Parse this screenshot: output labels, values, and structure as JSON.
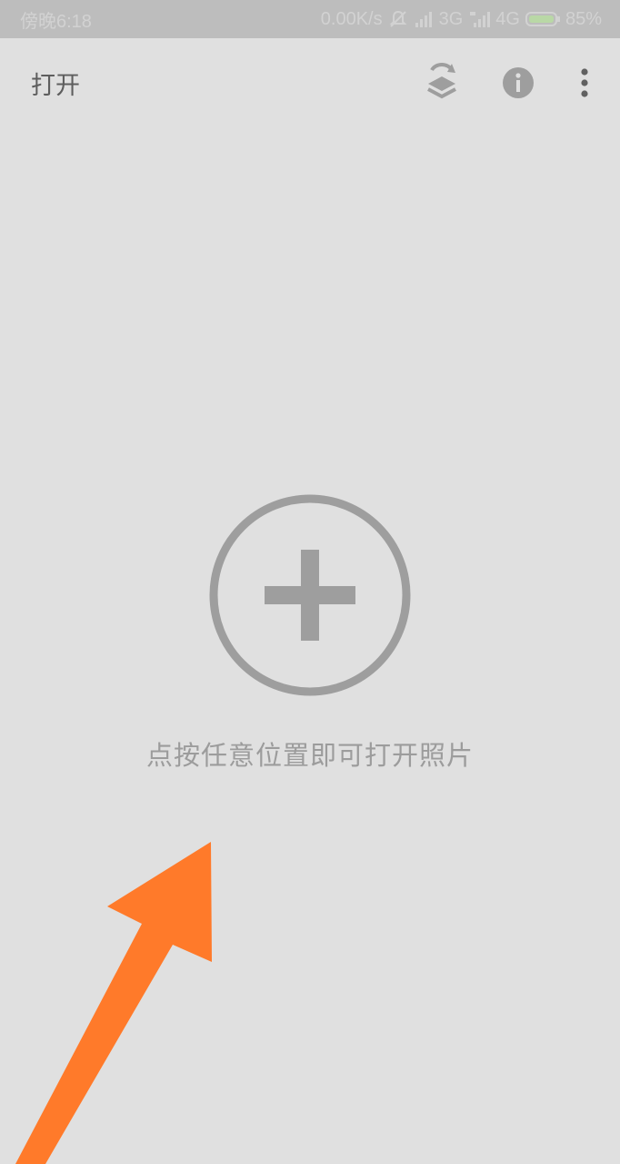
{
  "status_bar": {
    "time": "傍晚6:18",
    "net_speed": "0.00K/s",
    "net_3g": "3G",
    "net_4g": "4G",
    "battery": "85%"
  },
  "app_bar": {
    "title": "打开",
    "icons": [
      "layers-sync-icon",
      "info-icon",
      "more-vert-icon"
    ]
  },
  "main": {
    "hint": "点按任意位置即可打开照片"
  },
  "colors": {
    "background": "#e0e0e0",
    "status_bar": "#bdbdbd",
    "icon_gray": "#9e9e9e",
    "annotation_arrow": "#ff7a2a"
  }
}
